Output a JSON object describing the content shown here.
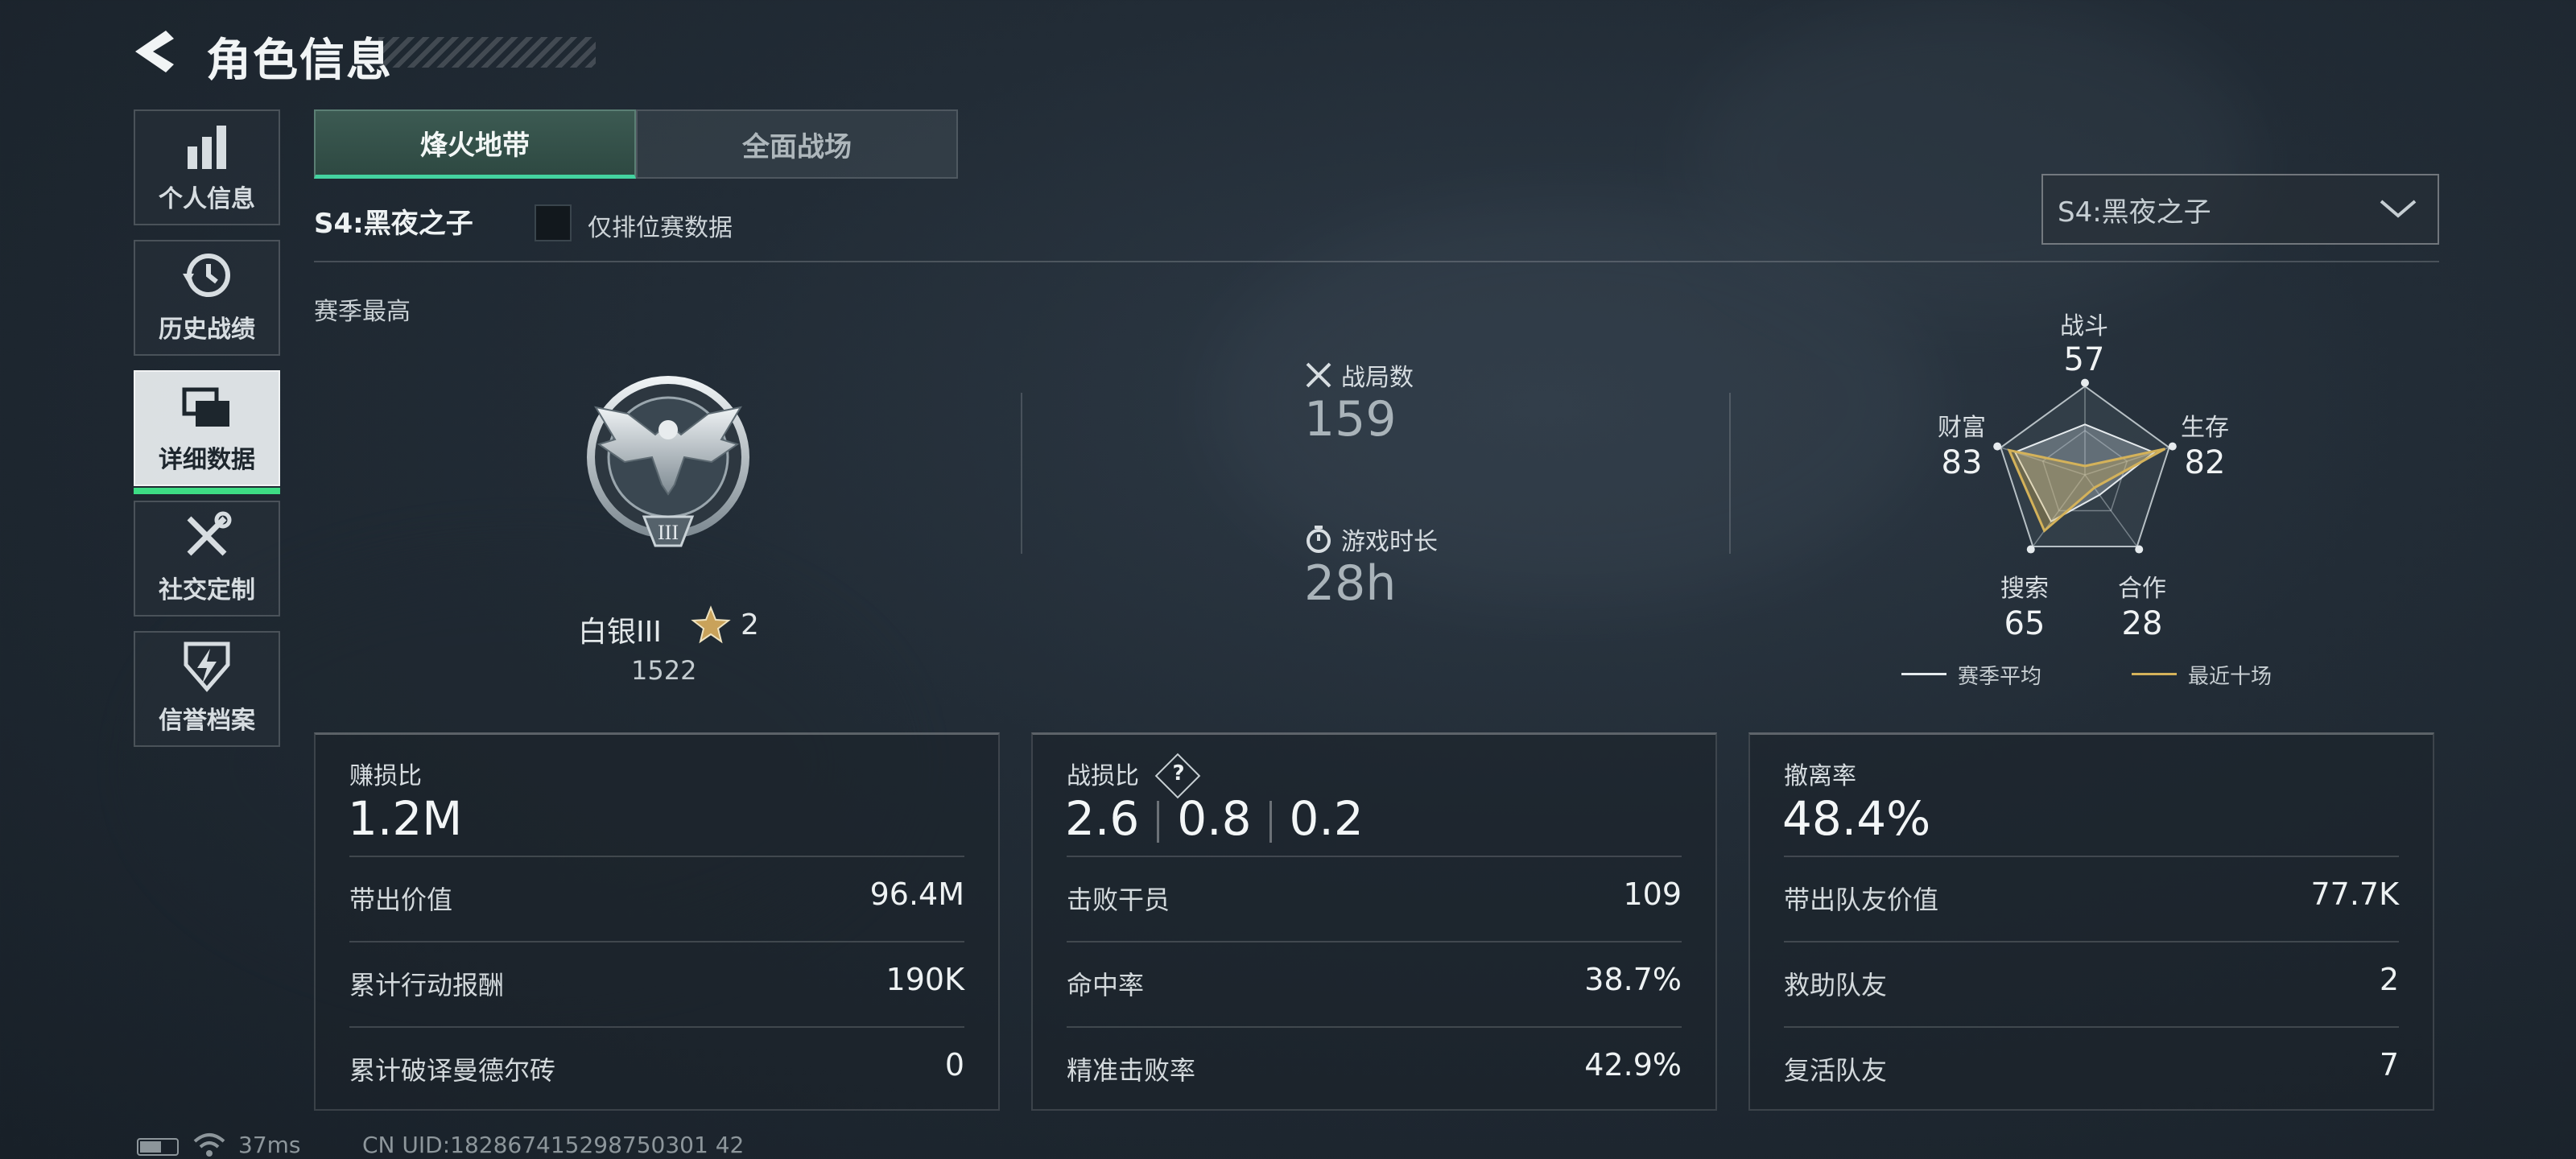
{
  "header": {
    "title": "角色信息"
  },
  "sidebar": {
    "items": [
      {
        "label": "个人信息",
        "icon": "bar-chart-icon"
      },
      {
        "label": "历史战绩",
        "icon": "history-icon"
      },
      {
        "label": "详细数据",
        "icon": "cards-icon",
        "active": true
      },
      {
        "label": "社交定制",
        "icon": "tools-icon"
      },
      {
        "label": "信誉档案",
        "icon": "shield-bolt-icon"
      }
    ]
  },
  "mode_tabs": [
    {
      "label": "烽火地带",
      "active": true
    },
    {
      "label": "全面战场",
      "active": false
    }
  ],
  "season": {
    "label": "S4:黑夜之子",
    "ranked_only_label": "仅排位赛数据",
    "ranked_only_checked": false,
    "select_value": "S4:黑夜之子"
  },
  "season_best": {
    "label": "赛季最高",
    "rank_name": "白银III",
    "rank_numeral": "III",
    "stars": "2",
    "score": "1522"
  },
  "summary": {
    "matches_label": "战局数",
    "matches_value": "159",
    "playtime_label": "游戏时长",
    "playtime_value": "28h"
  },
  "radar": {
    "axes": [
      {
        "label": "战斗",
        "value": "57"
      },
      {
        "label": "生存",
        "value": "82"
      },
      {
        "label": "合作",
        "value": "28"
      },
      {
        "label": "搜索",
        "value": "65"
      },
      {
        "label": "财富",
        "value": "83"
      }
    ],
    "legend": [
      {
        "label": "赛季平均",
        "color": "#e6ebee"
      },
      {
        "label": "最近十场",
        "color": "#d4b25a"
      }
    ],
    "season_avg": [
      57,
      82,
      28,
      65,
      83
    ],
    "recent_ten": [
      10,
      95,
      18,
      78,
      90
    ]
  },
  "cards": [
    {
      "title": "赚损比",
      "main": "1.2M",
      "rows": [
        {
          "label": "带出价值",
          "value": "96.4M"
        },
        {
          "label": "累计行动报酬",
          "value": "190K"
        },
        {
          "label": "累计破译曼德尔砖",
          "value": "0"
        }
      ]
    },
    {
      "title": "战损比",
      "help": "?",
      "main_parts": [
        "2.6",
        "0.8",
        "0.2"
      ],
      "rows": [
        {
          "label": "击败干员",
          "value": "109"
        },
        {
          "label": "命中率",
          "value": "38.7%"
        },
        {
          "label": "精准击败率",
          "value": "42.9%"
        }
      ]
    },
    {
      "title": "撤离率",
      "main": "48.4%",
      "rows": [
        {
          "label": "带出队友价值",
          "value": "77.7K"
        },
        {
          "label": "救助队友",
          "value": "2"
        },
        {
          "label": "复活队友",
          "value": "7"
        }
      ]
    }
  ],
  "footer": {
    "ping": "37ms",
    "uid": "CN UID:182867415298750301 42"
  }
}
